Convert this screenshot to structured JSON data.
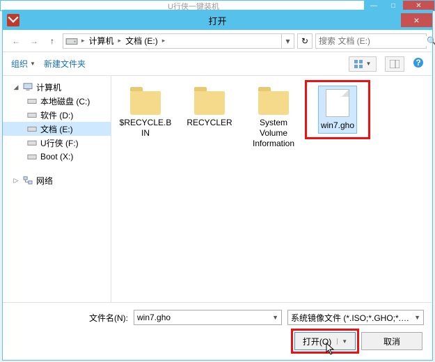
{
  "bg_window": {
    "title": "U行侠一键装机"
  },
  "dialog": {
    "title": "打开",
    "close": "×"
  },
  "nav": {
    "back": "←",
    "fwd": "→",
    "up": "↑",
    "breadcrumb": {
      "seg1": "计算机",
      "seg2": "文档 (E:)"
    },
    "refresh": "↻",
    "search_placeholder": "搜索 文档 (E:)"
  },
  "toolbar": {
    "organize": "组织",
    "new_folder": "新建文件夹",
    "help": "?"
  },
  "tree": {
    "computer": "计算机",
    "drives": [
      "本地磁盘 (C:)",
      "软件 (D:)",
      "文档 (E:)",
      "U行侠 (F:)",
      "Boot (X:)"
    ],
    "network": "网络"
  },
  "files": {
    "items": [
      {
        "name": "$RECYCLE.BIN",
        "type": "folder"
      },
      {
        "name": "RECYCLER",
        "type": "folder"
      },
      {
        "name": "System Volume Information",
        "type": "folder"
      },
      {
        "name": "win7.gho",
        "type": "file"
      }
    ]
  },
  "bottom": {
    "filename_label": "文件名(N):",
    "filename_value": "win7.gho",
    "filter_text": "系统镜像文件 (*.ISO;*.GHO;*.WIM)",
    "open_label": "打开(O)",
    "cancel_label": "取消"
  }
}
